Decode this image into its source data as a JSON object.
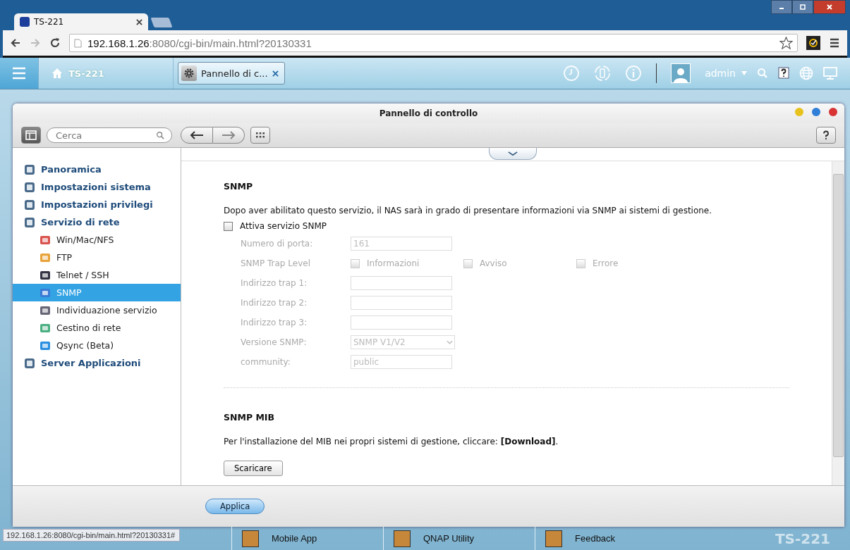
{
  "browser": {
    "tab_title": "TS-221",
    "address_host": "192.168.1.26",
    "address_rest": ":8080/cgi-bin/main.html?20130331",
    "status_url": "192.168.1.26:8080/cgi-bin/main.html?20130331#"
  },
  "top_bar": {
    "home_label": "TS-221",
    "app_tab": "Pannello di c...",
    "user": "admin"
  },
  "window": {
    "title": "Pannello di controllo",
    "search_placeholder": "Cerca"
  },
  "sidebar": {
    "items": [
      {
        "label": "Panoramica",
        "selected": false
      },
      {
        "label": "Impostazioni sistema",
        "selected": false
      },
      {
        "label": "Impostazioni privilegi",
        "selected": false
      },
      {
        "label": "Servizio di rete",
        "selected": false,
        "children": [
          {
            "label": "Win/Mac/NFS",
            "selected": false
          },
          {
            "label": "FTP",
            "selected": false
          },
          {
            "label": "Telnet / SSH",
            "selected": false
          },
          {
            "label": "SNMP",
            "selected": true
          },
          {
            "label": "Individuazione servizio",
            "selected": false
          },
          {
            "label": "Cestino di rete",
            "selected": false
          },
          {
            "label": "Qsync (Beta)",
            "selected": false
          }
        ]
      },
      {
        "label": "Server Applicazioni",
        "selected": false
      }
    ]
  },
  "snmp": {
    "title": "SNMP",
    "description": "Dopo aver abilitato questo servizio, il NAS sarà in grado di presentare informazioni via SNMP ai sistemi di gestione.",
    "enable": {
      "label": "Attiva servizio SNMP",
      "checked": false
    },
    "fields": [
      {
        "kind": "input",
        "label": "Numero di porta:",
        "value": "161"
      },
      {
        "kind": "checks",
        "label": "SNMP Trap Level",
        "options": [
          {
            "label": "Informazioni",
            "checked": false
          },
          {
            "label": "Avviso",
            "checked": false
          },
          {
            "label": "Errore",
            "checked": false
          }
        ]
      },
      {
        "kind": "input",
        "label": "Indirizzo trap 1:"
      },
      {
        "kind": "input",
        "label": "Indirizzo trap 2:"
      },
      {
        "kind": "input",
        "label": "Indirizzo trap 3:"
      },
      {
        "kind": "select",
        "label": "Versione SNMP:",
        "value": "SNMP V1/V2"
      },
      {
        "kind": "input",
        "label": "community:",
        "value": "public"
      }
    ]
  },
  "mib": {
    "title": "SNMP MIB",
    "text": "Per l'installazione del MIB nei propri sistemi di gestione, cliccare: **[Download]**.",
    "button": "Scaricare"
  },
  "footer": {
    "apply": "Applica"
  },
  "desktop": {
    "apps": [
      "Mobile App",
      "QNAP Utility",
      "Feedback"
    ],
    "brand": "TS-221"
  }
}
